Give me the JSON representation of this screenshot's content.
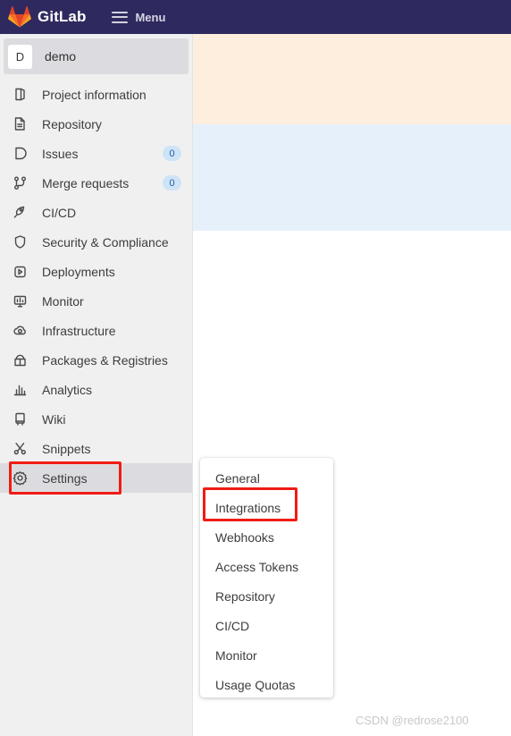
{
  "topbar": {
    "logo_icon": "gitlab-fox-logo",
    "brand": "GitLab",
    "menu_icon": "hamburger-icon",
    "menu_label": "Menu"
  },
  "sidebar": {
    "project": {
      "avatar_initial": "D",
      "name": "demo"
    },
    "items": [
      {
        "icon": "project-information-icon",
        "label": "Project information",
        "badge": ""
      },
      {
        "icon": "repository-icon",
        "label": "Repository",
        "badge": ""
      },
      {
        "icon": "issues-icon",
        "label": "Issues",
        "badge": "0"
      },
      {
        "icon": "merge-requests-icon",
        "label": "Merge requests",
        "badge": "0"
      },
      {
        "icon": "cicd-rocket-icon",
        "label": "CI/CD",
        "badge": ""
      },
      {
        "icon": "shield-icon",
        "label": "Security & Compliance",
        "badge": ""
      },
      {
        "icon": "deployments-icon",
        "label": "Deployments",
        "badge": ""
      },
      {
        "icon": "monitor-icon",
        "label": "Monitor",
        "badge": ""
      },
      {
        "icon": "infrastructure-cloud-icon",
        "label": "Infrastructure",
        "badge": ""
      },
      {
        "icon": "packages-box-icon",
        "label": "Packages & Registries",
        "badge": ""
      },
      {
        "icon": "analytics-chart-icon",
        "label": "Analytics",
        "badge": ""
      },
      {
        "icon": "wiki-book-icon",
        "label": "Wiki",
        "badge": ""
      },
      {
        "icon": "snippets-scissors-icon",
        "label": "Snippets",
        "badge": ""
      },
      {
        "icon": "settings-gear-icon",
        "label": "Settings",
        "badge": ""
      }
    ]
  },
  "submenu": {
    "items": [
      {
        "label": "General"
      },
      {
        "label": "Integrations"
      },
      {
        "label": "Webhooks"
      },
      {
        "label": "Access Tokens"
      },
      {
        "label": "Repository"
      },
      {
        "label": "CI/CD"
      },
      {
        "label": "Monitor"
      },
      {
        "label": "Usage Quotas"
      }
    ]
  },
  "annotations": {
    "settings_highlight": "Settings",
    "integrations_highlight": "Integrations",
    "color": "#f01c14"
  },
  "watermark": "CSDN @redrose2100",
  "colors": {
    "navbar": "#2e2a5f",
    "sidebar": "#f0f0f0",
    "sidebar_active": "#dcdce0",
    "banner_cream": "#fdeedd",
    "banner_blue": "#e5f0fb",
    "badge_bg": "#cfe3f7",
    "badge_text": "#1f5fa9"
  }
}
